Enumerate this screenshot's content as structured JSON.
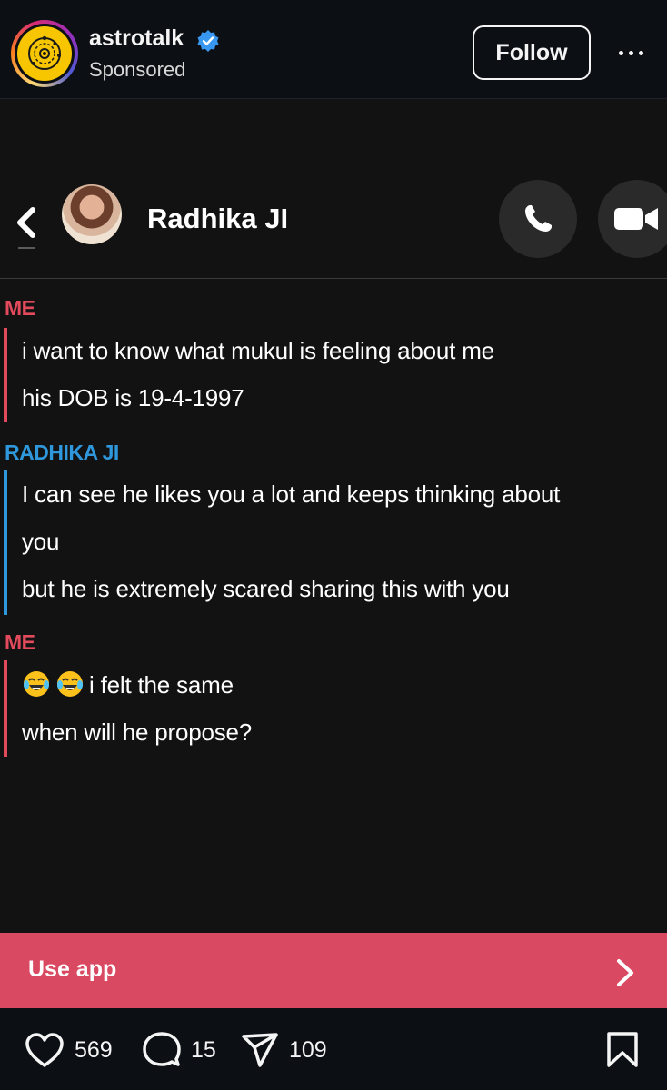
{
  "post": {
    "account_name": "astrotalk",
    "verified": true,
    "sponsored_label": "Sponsored",
    "follow_label": "Follow",
    "more_icon": "more-horizontal-icon"
  },
  "chat": {
    "contact_name": "Radhika JI",
    "messages": [
      {
        "sender": "ME",
        "color": "#e34a5c",
        "lines": [
          "i want to know what mukul is feeling about me",
          "his DOB is 19-4-1997"
        ]
      },
      {
        "sender": "RADHIKA JI",
        "color": "#2f98dd",
        "lines": [
          "I can see he likes you a lot and keeps thinking about",
          "you",
          "but he is extremely scared sharing this with you"
        ]
      },
      {
        "sender": "ME",
        "color": "#e34a5c",
        "lines": [
          "i felt the same",
          "when will he propose?"
        ],
        "emoji": "face-with-tears-of-joy x2"
      }
    ]
  },
  "cta": {
    "label": "Use app",
    "color": "#d94a62"
  },
  "actions": {
    "likes": "569",
    "comments": "15",
    "shares": "109"
  }
}
